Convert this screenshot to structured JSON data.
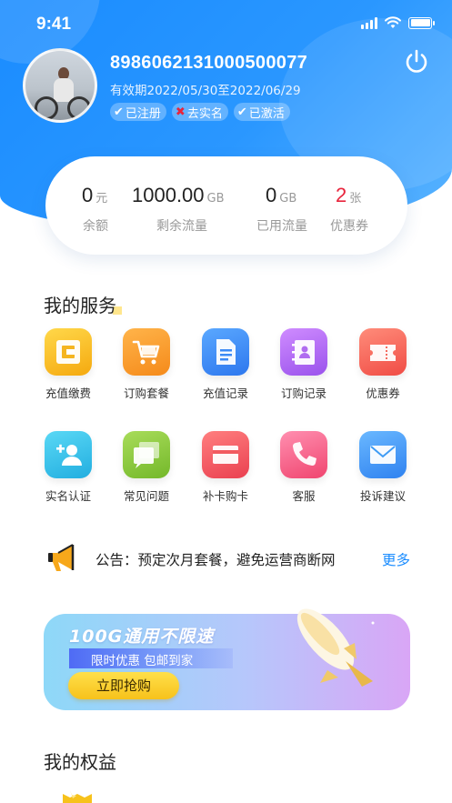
{
  "status_bar": {
    "time": "9:41"
  },
  "profile": {
    "phone_number": "8986062131000500077",
    "validity": "有效期2022/05/30至2022/06/29",
    "tags": [
      {
        "icon": "check",
        "label": "已注册"
      },
      {
        "icon": "cross",
        "label": "去实名"
      },
      {
        "icon": "check",
        "label": "已激活"
      }
    ]
  },
  "stats": [
    {
      "value": "0",
      "unit": "元",
      "label": "余额"
    },
    {
      "value": "1000.00",
      "unit": "GB",
      "label": "剩余流量"
    },
    {
      "value": "0",
      "unit": "GB",
      "label": "已用流量"
    },
    {
      "value": "2",
      "unit": "张",
      "label": "优惠券",
      "color": "#e8243c"
    }
  ],
  "services": {
    "title": "我的服务",
    "items": [
      {
        "label": "充值缴费",
        "icon": "card-c-icon",
        "color": "#f7b21b"
      },
      {
        "label": "订购套餐",
        "icon": "cart-icon",
        "color": "#f79a2a"
      },
      {
        "label": "充值记录",
        "icon": "document-icon",
        "color": "#3d8bf5"
      },
      {
        "label": "订购记录",
        "icon": "contact-book-icon",
        "color": "#b06df0"
      },
      {
        "label": "优惠券",
        "icon": "ticket-icon",
        "color": "#f56a5e"
      },
      {
        "label": "实名认证",
        "icon": "add-user-icon",
        "color": "#2ec2e8"
      },
      {
        "label": "常见问题",
        "icon": "chat-icon",
        "color": "#8ccb3a"
      },
      {
        "label": "补卡购卡",
        "icon": "card-icon",
        "color": "#f25a60"
      },
      {
        "label": "客服",
        "icon": "phone-icon",
        "color": "#f55f85"
      },
      {
        "label": "投诉建议",
        "icon": "mail-icon",
        "color": "#3d9bf5"
      }
    ]
  },
  "notice": {
    "text": "公告：预定次月套餐，避免运营商断网",
    "more": "更多"
  },
  "banner": {
    "headline": "100G通用不限速",
    "subtitle": "限时优惠 包邮到家",
    "cta": "立即抢购"
  },
  "rights": {
    "title": "我的权益"
  }
}
